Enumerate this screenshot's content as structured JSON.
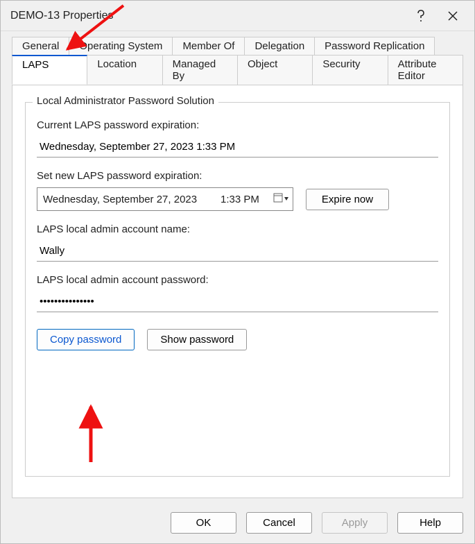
{
  "window": {
    "title": "DEMO-13 Properties"
  },
  "tabs_row1": [
    "General",
    "Operating System",
    "Member Of",
    "Delegation",
    "Password Replication"
  ],
  "tabs_row2": [
    "LAPS",
    "Location",
    "Managed By",
    "Object",
    "Security",
    "Attribute Editor"
  ],
  "active_tab": "LAPS",
  "group": {
    "legend": "Local Administrator Password Solution",
    "current_exp_label": "Current LAPS password expiration:",
    "current_exp_value": "Wednesday, September 27, 2023 1:33 PM",
    "set_new_label": "Set new LAPS password expiration:",
    "set_new_date": "Wednesday, September 27, 2023",
    "set_new_time": "1:33 PM",
    "expire_now_label": "Expire now",
    "admin_name_label": "LAPS local admin account name:",
    "admin_name_value": "Wally",
    "admin_pwd_label": "LAPS local admin account password:",
    "admin_pwd_value": "•••••••••••••••",
    "copy_pwd_label": "Copy password",
    "show_pwd_label": "Show password"
  },
  "footer": {
    "ok": "OK",
    "cancel": "Cancel",
    "apply": "Apply",
    "help": "Help"
  },
  "annotation_color": "#e11"
}
